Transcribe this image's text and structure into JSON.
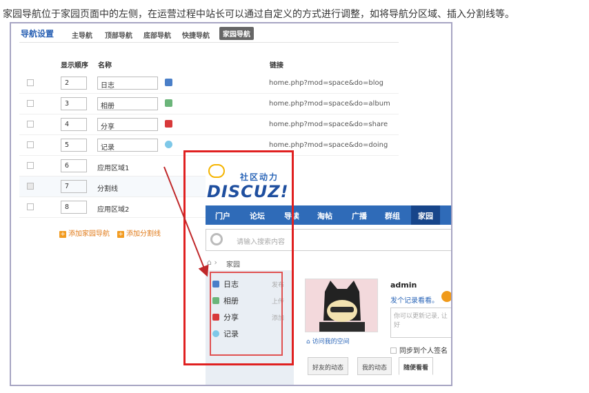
{
  "caption": "家园导航位于家园页面中的左侧，在运营过程中站长可以通过自定义的方式进行调整，如将导航分区域、插入分割线等。",
  "tabs": {
    "title": "导航设置",
    "items": [
      "主导航",
      "顶部导航",
      "底部导航",
      "快捷导航"
    ],
    "active": "家园导航"
  },
  "table": {
    "headers": {
      "order": "显示顺序",
      "name": "名称",
      "link": "链接"
    },
    "rows": [
      {
        "order": "2",
        "name": "日志",
        "link": "home.php?mod=space&do=blog",
        "editable": true
      },
      {
        "order": "3",
        "name": "相册",
        "link": "home.php?mod=space&do=album",
        "editable": true
      },
      {
        "order": "4",
        "name": "分享",
        "link": "home.php?mod=space&do=share",
        "editable": true
      },
      {
        "order": "5",
        "name": "记录",
        "link": "home.php?mod=space&do=doing",
        "editable": true
      },
      {
        "order": "6",
        "name": "应用区域1",
        "link": "",
        "editable": false
      },
      {
        "order": "7",
        "name": "分割线",
        "link": "",
        "editable": false
      },
      {
        "order": "8",
        "name": "应用区域2",
        "link": "",
        "editable": false
      }
    ],
    "add_home_nav": "添加家园导航",
    "add_separator": "添加分割线"
  },
  "discuz": {
    "slogan": "社区动力",
    "logo": "DISCUZ!",
    "nav": [
      "门户",
      "论坛",
      "导读",
      "淘帖",
      "广播",
      "群组",
      "家园"
    ],
    "nav_active": "家园",
    "search_placeholder": "请输入搜索内容",
    "breadcrumb": "家园",
    "side_items": [
      {
        "label": "日志",
        "action": "发布"
      },
      {
        "label": "相册",
        "action": "上传"
      },
      {
        "label": "分享",
        "action": "添加"
      },
      {
        "label": "记录",
        "action": ""
      }
    ],
    "username": "admin",
    "record_prompt": "发个记录看看。",
    "status_placeholder": "你可以更新记录, 让好",
    "visit_space": "访问我的空间",
    "sync_label": "同步到个人签名",
    "feed_tabs": [
      "好友的动态",
      "我的动态",
      "随便看看"
    ],
    "feed_active": "随便看看"
  },
  "colors": {
    "accent": "#2f6bb8",
    "highlight": "#e02020",
    "add": "#e07a19"
  }
}
